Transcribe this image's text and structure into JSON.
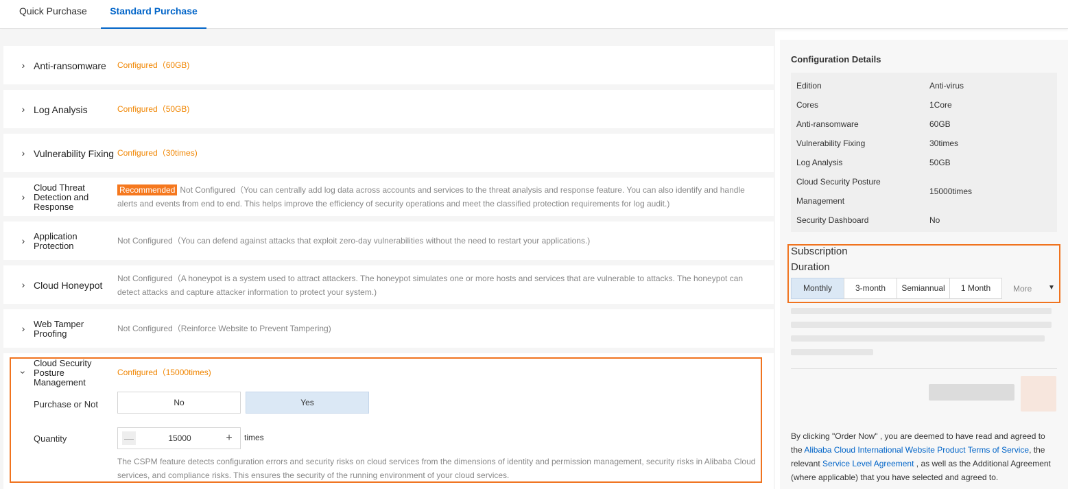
{
  "tabs": [
    {
      "label": "Quick Purchase"
    },
    {
      "label": "Standard Purchase"
    }
  ],
  "sections": [
    {
      "title": "Anti-ransomware",
      "status": "Configured（60GB)"
    },
    {
      "title": "Log Analysis",
      "status": "Configured（50GB)"
    },
    {
      "title": "Vulnerability Fixing",
      "status": "Configured（30times)"
    },
    {
      "title": "Cloud Threat Detection and Response",
      "badge": "Recommended",
      "status": "Not Configured（You can centrally add log data across accounts and services to the threat analysis and response feature. You can also identify and handle alerts and events from end to end. This helps improve the efficiency of security operations and meet the classified protection requirements for log audit.)"
    },
    {
      "title": "Application Protection",
      "status": "Not Configured（You can defend against attacks that exploit zero-day vulnerabilities without the need to restart your applications.)"
    },
    {
      "title": "Cloud Honeypot",
      "status": "Not Configured（A honeypot is a system used to attract attackers. The honeypot simulates one or more hosts and services that are vulnerable to attacks. The honeypot can detect attacks and capture attacker information to protect your system.)"
    },
    {
      "title": "Web Tamper Proofing",
      "status": "Not Configured（Reinforce Website to Prevent Tampering)"
    },
    {
      "title": "Cloud Security Posture Management",
      "status": "Configured（15000times)"
    }
  ],
  "cspm": {
    "purchase_label": "Purchase or Not",
    "option_no": "No",
    "option_yes": "Yes",
    "selected": "Yes",
    "quantity_label": "Quantity",
    "minus": "—",
    "plus": "+",
    "quantity_value": "15000",
    "unit": "times",
    "note": "The CSPM feature detects configuration errors and security risks on cloud services from the dimensions of identity and permission management, security risks in Alibaba Cloud services, and compliance risks. This ensures the security of the running environment of your cloud services."
  },
  "config": {
    "title": "Configuration Details",
    "rows": [
      {
        "key": "Edition",
        "value": "Anti-virus"
      },
      {
        "key": "Cores",
        "value": "1Core"
      },
      {
        "key": "Anti-ransomware",
        "value": "60GB"
      },
      {
        "key": "Vulnerability Fixing",
        "value": "30times"
      },
      {
        "key": "Log Analysis",
        "value": "50GB"
      },
      {
        "key": "Cloud Security Posture",
        "key2": "Management",
        "value": "15000times"
      },
      {
        "key": "Security Dashboard",
        "value": "No"
      }
    ]
  },
  "subscription": {
    "label1": "Subscription",
    "label2": "Duration",
    "options": [
      "Monthly",
      "3-month",
      "Semiannual",
      "1 Month"
    ],
    "selected": "Monthly",
    "more": "More"
  },
  "legal": {
    "p1": "By clicking \"Order Now\" , you are deemed to have read and agreed to the ",
    "link1": "Alibaba Cloud International Website Product Terms of Service",
    "p2": ", the relevant ",
    "link2": "Service Level Agreement",
    "p3": " , as well as the Additional Agreement (where applicable) that you have selected and agreed to."
  },
  "colors": {
    "accent": "#0064c8",
    "configured": "#f08500",
    "highlight": "#f0731e",
    "badge": "#f5781e",
    "selected_bg": "#dbe8f5"
  }
}
